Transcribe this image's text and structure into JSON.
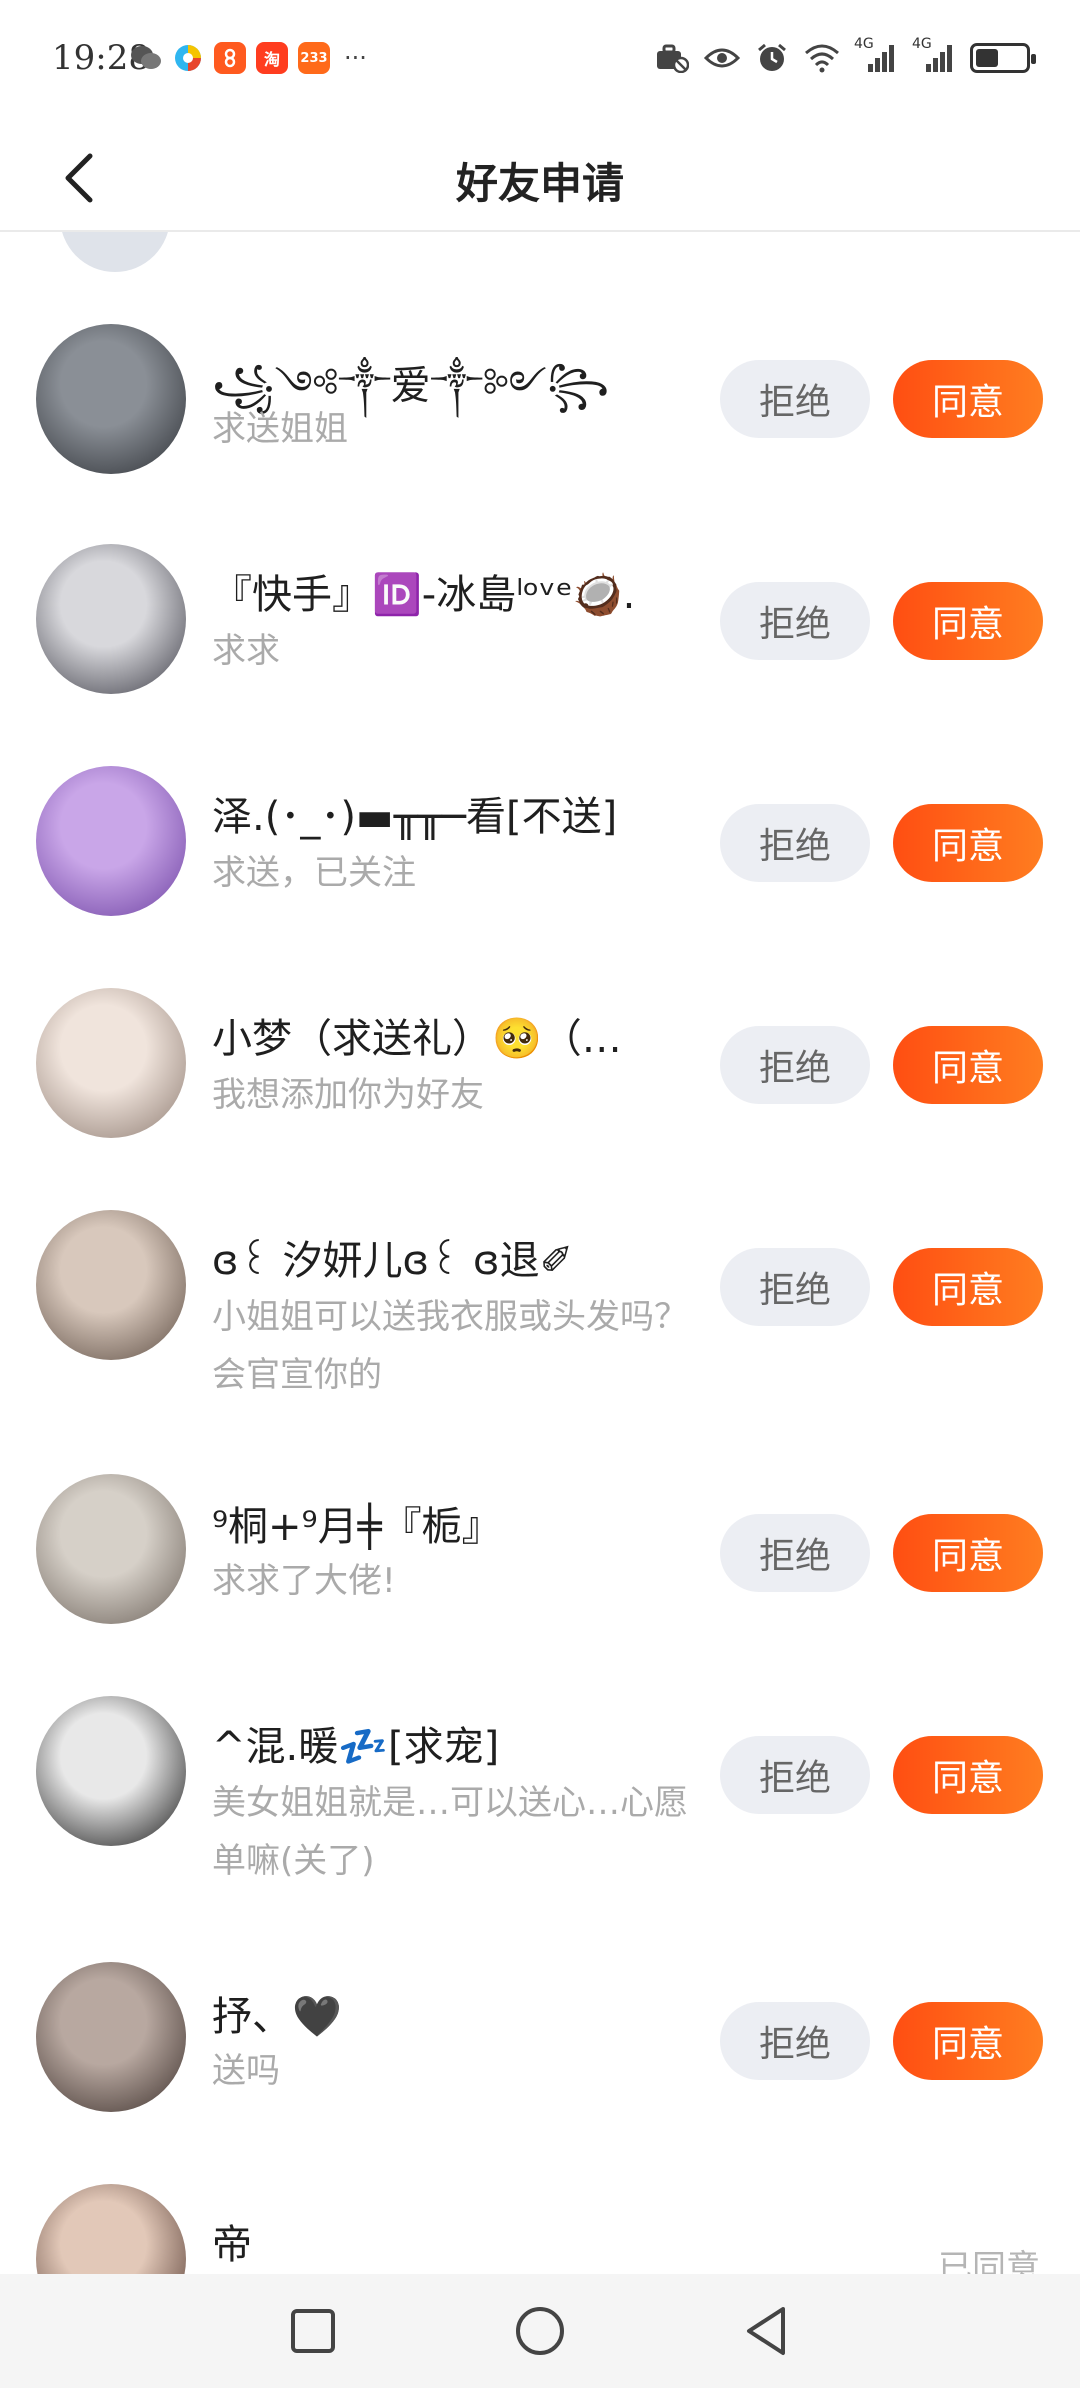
{
  "status_bar": {
    "time": "19:28",
    "apps": [
      {
        "icon": "wechat-icon",
        "label": "",
        "color": "#444444"
      },
      {
        "icon": "browser-icon",
        "label": "",
        "color": "#22aaee"
      },
      {
        "icon": "app-orange-icon",
        "label": "",
        "color": "#ff5a1f"
      },
      {
        "icon": "taobao-icon",
        "label": "淘",
        "color": "#ff3d1f"
      },
      {
        "icon": "233-icon",
        "label": "233",
        "color": "#ff6a1a"
      }
    ],
    "more": "···",
    "network_1": "4G",
    "network_2": "4G",
    "battery_level": 0.45
  },
  "header": {
    "back_icon": "chevron-left-icon",
    "title": "好友申请"
  },
  "requests": [
    {
      "name": "꧁༺༒爱༒༻꧂",
      "message": "求送姐姐",
      "avatar_colors": [
        "#8a8f96",
        "#2b2e33"
      ],
      "reject": "拒绝",
      "accept": "同意"
    },
    {
      "name": "『快手』🆔-冰島ˡᵒᵛᵉ🥥.",
      "message": "求求",
      "avatar_colors": [
        "#d8d8dc",
        "#3a3a44"
      ],
      "reject": "拒绝",
      "accept": "同意"
    },
    {
      "name": "泽.(･_･)▬╥╥─看[不送]",
      "message": "求送，已关注",
      "avatar_colors": [
        "#c9a6e8",
        "#6b3fa0"
      ],
      "reject": "拒绝",
      "accept": "同意"
    },
    {
      "name": "小梦（求送礼）🥺（…",
      "message": "我想添加你为好友",
      "avatar_colors": [
        "#f0e4dc",
        "#8c7a70"
      ],
      "reject": "拒绝",
      "accept": "同意"
    },
    {
      "name": "ɞ꒰ 汐妍儿ɞ꒰ ɞ退✐",
      "message": "小姐姐可以送我衣服或头发吗？会官宣你的",
      "avatar_colors": [
        "#d8c8bc",
        "#5a4a40"
      ],
      "reject": "拒绝",
      "accept": "同意"
    },
    {
      "name": "⁹桐+⁹月╪『栀』",
      "message": "求求了大佬!",
      "avatar_colors": [
        "#d6d0c8",
        "#6a6058"
      ],
      "reject": "拒绝",
      "accept": "同意"
    },
    {
      "name": "^混.暖💤[求宠]",
      "message": "美女姐姐就是…可以送心…心愿单嘛(关了)",
      "avatar_colors": [
        "#e8e8e8",
        "#111111"
      ],
      "reject": "拒绝",
      "accept": "同意"
    },
    {
      "name": "抒、🖤",
      "message": "送吗",
      "avatar_colors": [
        "#b8a8a0",
        "#3a2e2a"
      ],
      "reject": "拒绝",
      "accept": "同意"
    }
  ],
  "last_request": {
    "name": "帝",
    "status": "已同意",
    "avatar_colors": [
      "#e2c8b8",
      "#4a3028"
    ]
  },
  "nav": {
    "recent_icon": "square-icon",
    "home_icon": "circle-icon",
    "back_icon": "triangle-back-icon"
  }
}
